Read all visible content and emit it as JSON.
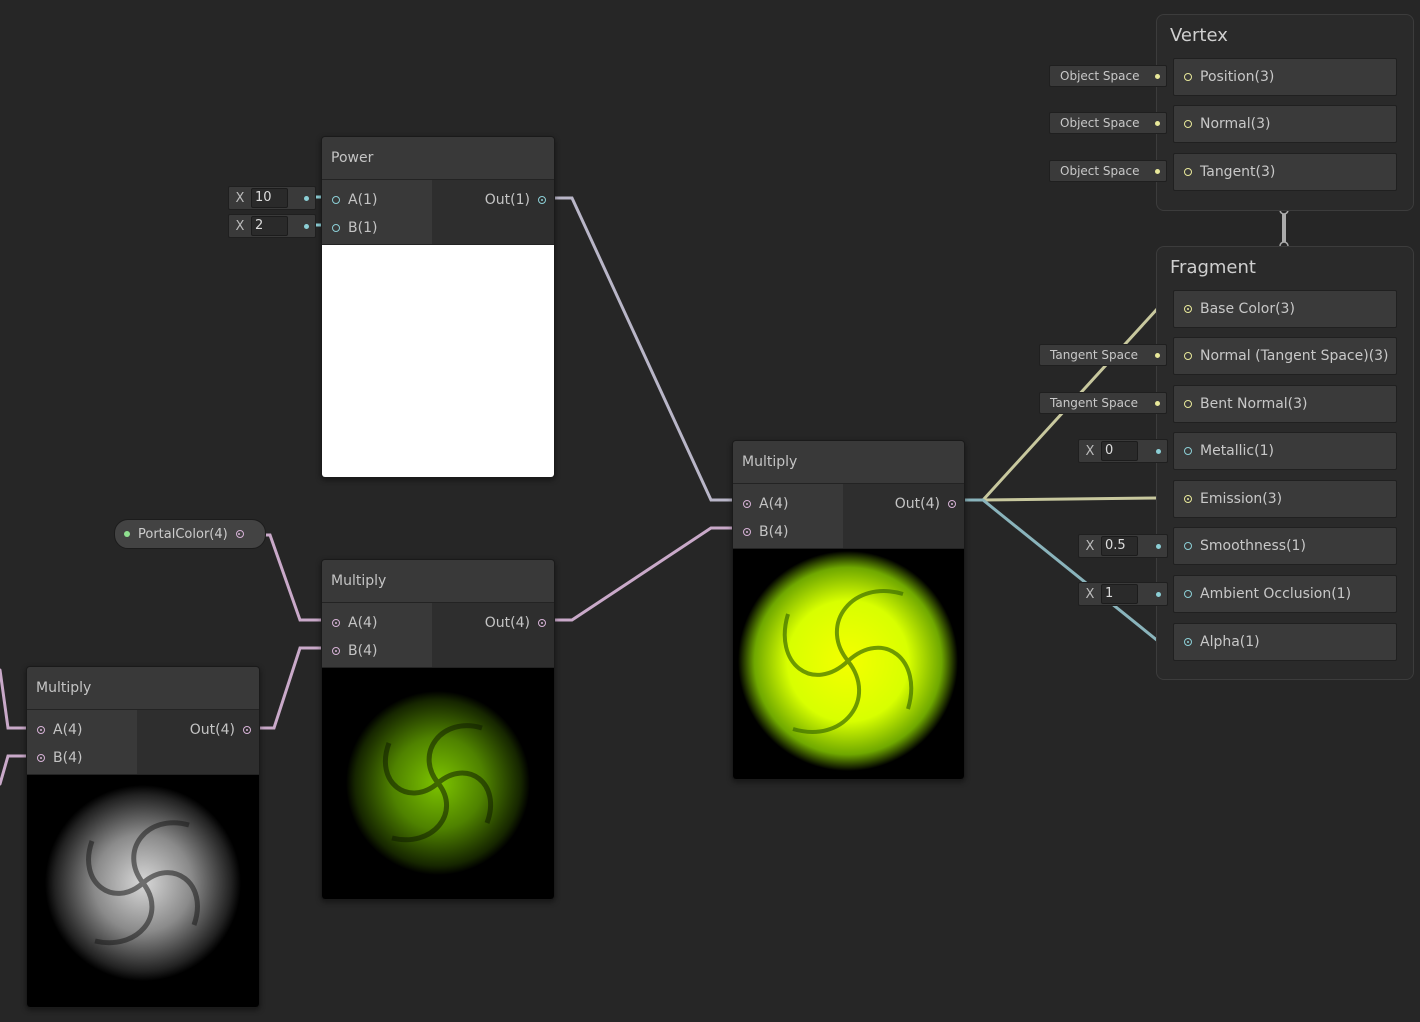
{
  "power": {
    "title": "Power",
    "in_a": "A(1)",
    "in_b": "B(1)",
    "out": "Out(1)",
    "field_a": {
      "axis": "X",
      "value": "10"
    },
    "field_b": {
      "axis": "X",
      "value": "2"
    }
  },
  "multiply_main": {
    "title": "Multiply",
    "in_a": "A(4)",
    "in_b": "B(4)",
    "out": "Out(4)"
  },
  "multiply_mid": {
    "title": "Multiply",
    "in_a": "A(4)",
    "in_b": "B(4)",
    "out": "Out(4)"
  },
  "multiply_left": {
    "title": "Multiply",
    "in_a": "A(4)",
    "in_b": "B(4)",
    "out": "Out(4)"
  },
  "property": {
    "label": "PortalColor(4)"
  },
  "vertex": {
    "title": "Vertex",
    "blocks": [
      {
        "label": "Position(3)",
        "space": "Object Space"
      },
      {
        "label": "Normal(3)",
        "space": "Object Space"
      },
      {
        "label": "Tangent(3)",
        "space": "Object Space"
      }
    ]
  },
  "fragment": {
    "title": "Fragment",
    "blocks": [
      {
        "label": "Base Color(3)"
      },
      {
        "label": "Normal (Tangent Space)(3)",
        "space": "Tangent Space"
      },
      {
        "label": "Bent Normal(3)",
        "space": "Tangent Space"
      },
      {
        "label": "Metallic(1)",
        "axis": "X",
        "value": "0"
      },
      {
        "label": "Emission(3)"
      },
      {
        "label": "Smoothness(1)",
        "axis": "X",
        "value": "0.5"
      },
      {
        "label": "Ambient Occlusion(1)",
        "axis": "X",
        "value": "1"
      },
      {
        "label": "Alpha(1)"
      }
    ]
  },
  "colors": {
    "pink": "#d6b2d6",
    "cyan": "#8ccfd6",
    "yellow": "#e8e89a",
    "green": "#c6ff00"
  }
}
